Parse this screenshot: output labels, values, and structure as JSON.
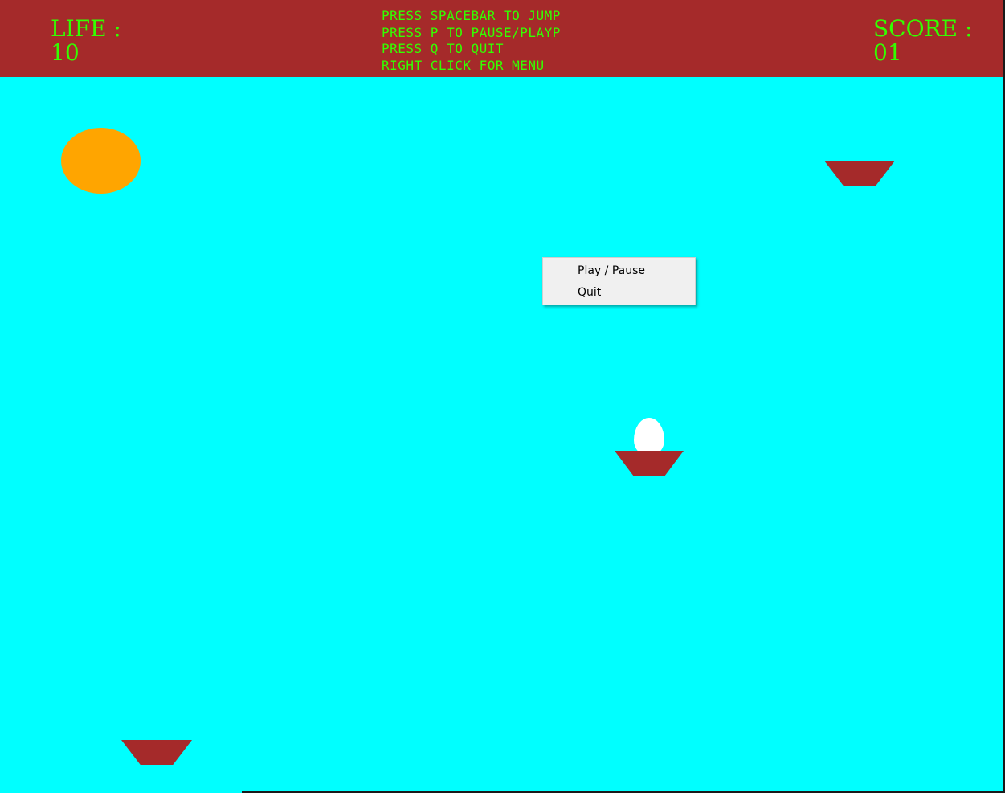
{
  "hud": {
    "life_label": "LIFE :",
    "life_value": "10",
    "score_label": "SCORE :",
    "score_value": "01",
    "instructions": [
      "PRESS SPACEBAR TO JUMP",
      "PRESS P TO PAUSE/PLAYP",
      "PRESS Q TO QUIT",
      "RIGHT CLICK FOR MENU"
    ]
  },
  "context_menu": {
    "items": [
      "Play / Pause",
      "Quit"
    ]
  },
  "colors": {
    "background": "#00ffff",
    "hud_bar": "#a52a2a",
    "hud_text": "#33ff00",
    "sun": "#ffa500",
    "platform": "#a52a2a",
    "egg": "#ffffff"
  }
}
